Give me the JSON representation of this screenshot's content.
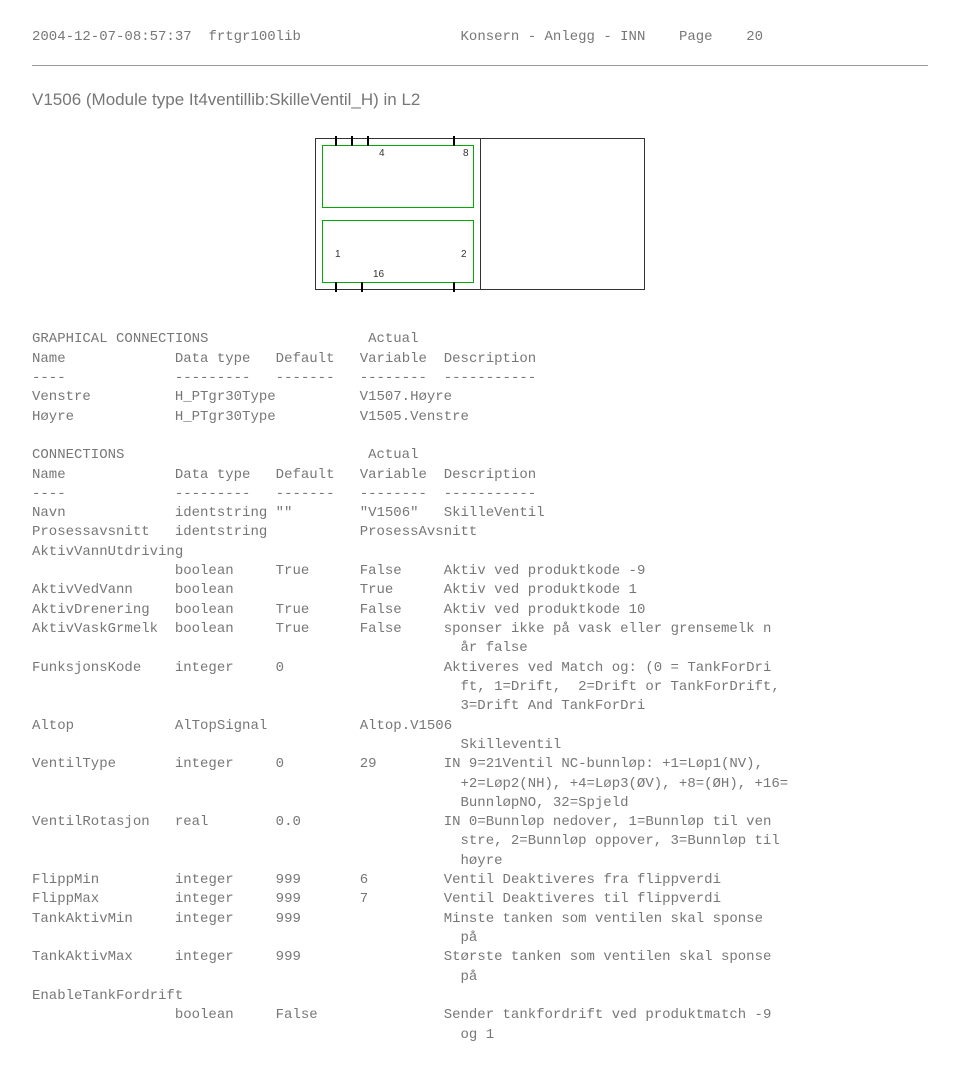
{
  "header": {
    "timestamp": "2004-12-07-08:57:37",
    "lib": "frtgr100lib",
    "center": "Konsern - Anlegg - INN",
    "page_label": "Page",
    "page_num": "20"
  },
  "title": "V1506 (Module type It4ventillib:SkilleVentil_H) in L2",
  "diagram": {
    "n4": "4",
    "n8": "8",
    "n1": "1",
    "n2": "2",
    "n16": "16"
  },
  "gc": {
    "heading": "GRAPHICAL CONNECTIONS",
    "actual": "Actual",
    "cols": {
      "c1": "Name",
      "c2": "Data type",
      "c3": "Default",
      "c4": "Variable",
      "c5": "Description"
    },
    "dash": {
      "d1": "----",
      "d2": "---------",
      "d3": "-------",
      "d4": "--------",
      "d5": "-----------"
    },
    "r1": {
      "name": "Venstre",
      "type": "H_PTgr30Type",
      "var": "V1507.Høyre"
    },
    "r2": {
      "name": "Høyre",
      "type": "H_PTgr30Type",
      "var": "V1505.Venstre"
    }
  },
  "cn": {
    "heading": "CONNECTIONS",
    "actual": "Actual",
    "cols": {
      "c1": "Name",
      "c2": "Data type",
      "c3": "Default",
      "c4": "Variable",
      "c5": "Description"
    },
    "dash": {
      "d1": "----",
      "d2": "---------",
      "d3": "-------",
      "d4": "--------",
      "d5": "-----------"
    },
    "rows": {
      "navn": {
        "name": "Navn",
        "type": "identstring",
        "def": "\"\"",
        "var": "\"V1506\"",
        "desc": "SkilleVentil"
      },
      "pros": {
        "name": "Prosessavsnitt",
        "type": "identstring",
        "def": "",
        "var": "ProsessAvsnitt",
        "desc": ""
      },
      "avu_h": {
        "name": "AktivVannUtdriving",
        "type": "",
        "def": "",
        "var": "",
        "desc": ""
      },
      "avu": {
        "name": "",
        "type": "boolean",
        "def": "True",
        "var": "False",
        "desc": "Aktiv ved produktkode -9"
      },
      "avv": {
        "name": "AktivVedVann",
        "type": "boolean",
        "def": "",
        "var": "True",
        "desc": "Aktiv ved produktkode 1"
      },
      "adr": {
        "name": "AktivDrenering",
        "type": "boolean",
        "def": "True",
        "var": "False",
        "desc": "Aktiv ved produktkode 10"
      },
      "avg": {
        "name": "AktivVaskGrmelk",
        "type": "boolean",
        "def": "True",
        "var": "False",
        "desc": "sponser ikke på vask eller grensemelk n"
      },
      "avg2": {
        "desc": "år false"
      },
      "fk": {
        "name": "FunksjonsKode",
        "type": "integer",
        "def": "0",
        "var": "",
        "desc": "Aktiveres ved Match og: (0 = TankForDri"
      },
      "fk2": {
        "desc": "ft, 1=Drift,  2=Drift or TankForDrift,"
      },
      "fk3": {
        "desc": "3=Drift And TankForDri"
      },
      "altop": {
        "name": "Altop",
        "type": "AlTopSignal",
        "def": "",
        "var": "Altop.V1506",
        "desc": ""
      },
      "altop2": {
        "desc": "Skilleventil"
      },
      "vt": {
        "name": "VentilType",
        "type": "integer",
        "def": "0",
        "var": "29",
        "desc": "IN 9=21Ventil NC-bunnløp: +1=Løp1(NV),"
      },
      "vt2": {
        "desc": "+2=Løp2(NH), +4=Løp3(ØV), +8=(ØH), +16="
      },
      "vt3": {
        "desc": "BunnløpNO, 32=Spjeld"
      },
      "vr": {
        "name": "VentilRotasjon",
        "type": "real",
        "def": "0.0",
        "var": "",
        "desc": "IN 0=Bunnløp nedover, 1=Bunnløp til ven"
      },
      "vr2": {
        "desc": "stre, 2=Bunnløp oppover, 3=Bunnløp til"
      },
      "vr3": {
        "desc": "høyre"
      },
      "fmin": {
        "name": "FlippMin",
        "type": "integer",
        "def": "999",
        "var": "6",
        "desc": "Ventil Deaktiveres fra flippverdi"
      },
      "fmax": {
        "name": "FlippMax",
        "type": "integer",
        "def": "999",
        "var": "7",
        "desc": "Ventil Deaktiveres til flippverdi"
      },
      "tamin": {
        "name": "TankAktivMin",
        "type": "integer",
        "def": "999",
        "var": "",
        "desc": "Minste tanken som ventilen skal sponse"
      },
      "tamin2": {
        "desc": "på"
      },
      "tamax": {
        "name": "TankAktivMax",
        "type": "integer",
        "def": "999",
        "var": "",
        "desc": "Største tanken som ventilen skal sponse"
      },
      "tamax2": {
        "desc": " på"
      },
      "etf_h": {
        "name": "EnableTankFordrift",
        "type": "",
        "def": "",
        "var": "",
        "desc": ""
      },
      "etf": {
        "name": "",
        "type": "boolean",
        "def": "False",
        "var": "",
        "desc": "Sender tankfordrift ved produktmatch -9"
      },
      "etf2": {
        "desc": "og 1"
      }
    }
  }
}
